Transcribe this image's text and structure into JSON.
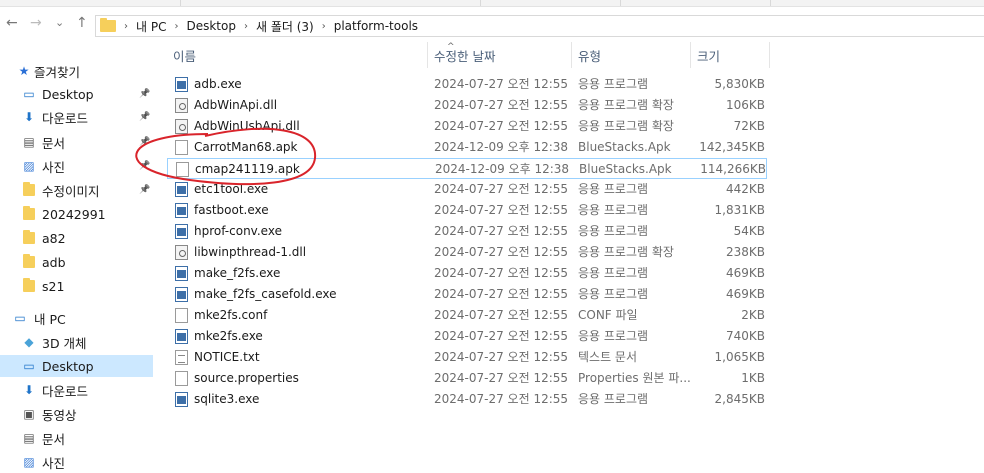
{
  "breadcrumb": [
    "내 PC",
    "Desktop",
    "새 폴더 (3)",
    "platform-tools"
  ],
  "nav": {
    "back": "←",
    "forward": "→",
    "recent": "⌄",
    "up": "↑"
  },
  "sidebar": {
    "items": [
      {
        "label": "즐겨찾기",
        "icon": "star-icon",
        "pinned": false
      },
      {
        "label": "Desktop",
        "icon": "desktop-icon",
        "pinned": true
      },
      {
        "label": "다운로드",
        "icon": "download-icon",
        "pinned": true
      },
      {
        "label": "문서",
        "icon": "document-icon",
        "pinned": true
      },
      {
        "label": "사진",
        "icon": "picture-icon",
        "pinned": true
      },
      {
        "label": "수정이미지",
        "icon": "folder-icon",
        "pinned": true
      },
      {
        "label": "20242991",
        "icon": "folder-icon",
        "pinned": false
      },
      {
        "label": "a82",
        "icon": "folder-icon",
        "pinned": false
      },
      {
        "label": "adb",
        "icon": "folder-icon",
        "pinned": false
      },
      {
        "label": "s21",
        "icon": "folder-icon",
        "pinned": false
      },
      {
        "label": "내 PC",
        "icon": "pc-icon",
        "pinned": false
      },
      {
        "label": "3D 개체",
        "icon": "cube-icon",
        "pinned": false
      },
      {
        "label": "Desktop",
        "icon": "desktop-icon",
        "pinned": false,
        "selected": true
      },
      {
        "label": "다운로드",
        "icon": "download-icon",
        "pinned": false
      },
      {
        "label": "동영상",
        "icon": "video-icon",
        "pinned": false
      },
      {
        "label": "문서",
        "icon": "document-icon",
        "pinned": false
      },
      {
        "label": "사진",
        "icon": "picture-icon",
        "pinned": false
      }
    ]
  },
  "columns": {
    "name": "이름",
    "date": "수정한 날짜",
    "type": "유형",
    "size": "크기"
  },
  "files": [
    {
      "name": "adb.exe",
      "date": "2024-07-27 오전 12:55",
      "type": "응용 프로그램",
      "size": "5,830KB",
      "icon": "exe"
    },
    {
      "name": "AdbWinApi.dll",
      "date": "2024-07-27 오전 12:55",
      "type": "응용 프로그램 확장",
      "size": "106KB",
      "icon": "dll"
    },
    {
      "name": "AdbWinUsbApi.dll",
      "date": "2024-07-27 오전 12:55",
      "type": "응용 프로그램 확장",
      "size": "72KB",
      "icon": "dll"
    },
    {
      "name": "CarrotMan68.apk",
      "date": "2024-12-09 오후 12:38",
      "type": "BlueStacks.Apk",
      "size": "142,345KB",
      "icon": "doc"
    },
    {
      "name": "cmap241119.apk",
      "date": "2024-12-09 오후 12:38",
      "type": "BlueStacks.Apk",
      "size": "114,266KB",
      "icon": "doc",
      "highlighted": true
    },
    {
      "name": "etc1tool.exe",
      "date": "2024-07-27 오전 12:55",
      "type": "응용 프로그램",
      "size": "442KB",
      "icon": "exe"
    },
    {
      "name": "fastboot.exe",
      "date": "2024-07-27 오전 12:55",
      "type": "응용 프로그램",
      "size": "1,831KB",
      "icon": "exe"
    },
    {
      "name": "hprof-conv.exe",
      "date": "2024-07-27 오전 12:55",
      "type": "응용 프로그램",
      "size": "54KB",
      "icon": "exe"
    },
    {
      "name": "libwinpthread-1.dll",
      "date": "2024-07-27 오전 12:55",
      "type": "응용 프로그램 확장",
      "size": "238KB",
      "icon": "dll"
    },
    {
      "name": "make_f2fs.exe",
      "date": "2024-07-27 오전 12:55",
      "type": "응용 프로그램",
      "size": "469KB",
      "icon": "exe"
    },
    {
      "name": "make_f2fs_casefold.exe",
      "date": "2024-07-27 오전 12:55",
      "type": "응용 프로그램",
      "size": "469KB",
      "icon": "exe"
    },
    {
      "name": "mke2fs.conf",
      "date": "2024-07-27 오전 12:55",
      "type": "CONF 파일",
      "size": "2KB",
      "icon": "doc"
    },
    {
      "name": "mke2fs.exe",
      "date": "2024-07-27 오전 12:55",
      "type": "응용 프로그램",
      "size": "740KB",
      "icon": "exe"
    },
    {
      "name": "NOTICE.txt",
      "date": "2024-07-27 오전 12:55",
      "type": "텍스트 문서",
      "size": "1,065KB",
      "icon": "txt"
    },
    {
      "name": "source.properties",
      "date": "2024-07-27 오전 12:55",
      "type": "Properties 원본 파...",
      "size": "1KB",
      "icon": "doc"
    },
    {
      "name": "sqlite3.exe",
      "date": "2024-07-27 오전 12:55",
      "type": "응용 프로그램",
      "size": "2,845KB",
      "icon": "exe"
    }
  ],
  "colors": {
    "selected_bg": "#cce8ff",
    "highlight_border": "#99d1ff",
    "annotation": "#d9242b"
  }
}
